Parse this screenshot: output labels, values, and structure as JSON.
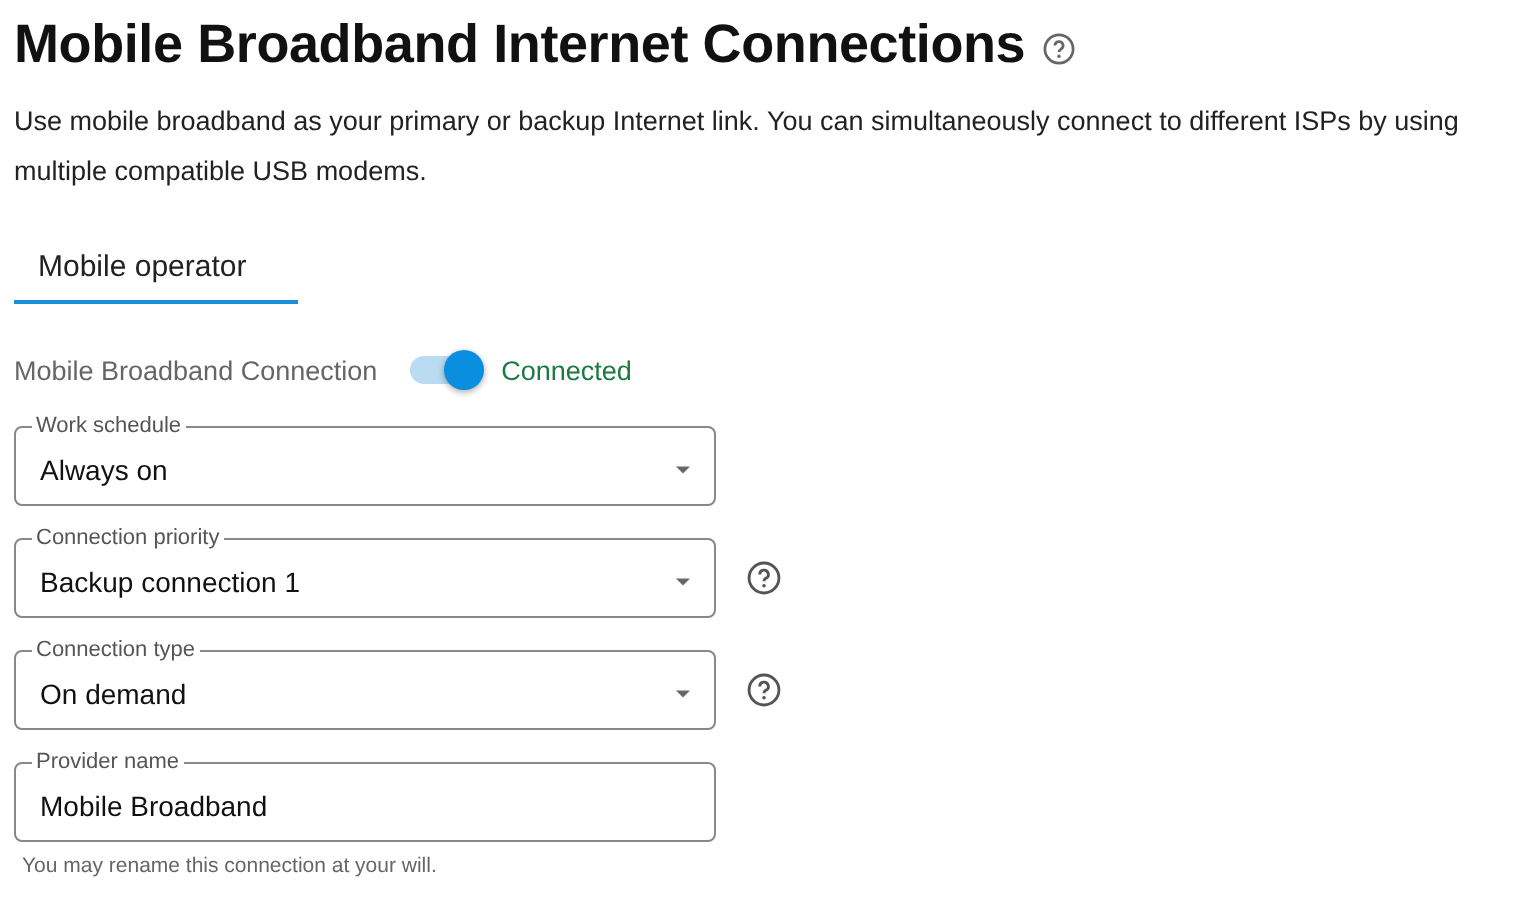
{
  "title": "Mobile Broadband Internet Connections",
  "description": "Use mobile broadband as your primary or backup Internet link. You can simultaneously connect to different ISPs by using multiple compatible USB modems.",
  "tabs": [
    {
      "label": "Mobile operator",
      "selected": true
    }
  ],
  "connection": {
    "label": "Mobile Broadband Connection",
    "on": true,
    "status": "Connected"
  },
  "fields": [
    {
      "kind": "select",
      "label": "Work schedule",
      "value": "Always on",
      "help": false
    },
    {
      "kind": "select",
      "label": "Connection priority",
      "value": "Backup connection 1",
      "help": true
    },
    {
      "kind": "select",
      "label": "Connection type",
      "value": "On demand",
      "help": true
    },
    {
      "kind": "text",
      "label": "Provider name",
      "value": "Mobile Broadband",
      "help": false,
      "hint": "You may rename this connection at your will."
    }
  ]
}
